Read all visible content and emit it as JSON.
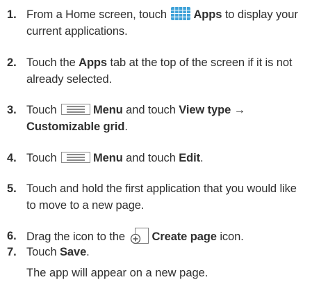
{
  "steps": [
    {
      "num": "1.",
      "line1_a": "From a Home screen, touch ",
      "apps_label": "Apps",
      "line1_b": " to display your",
      "line2": "current applications."
    },
    {
      "num": "2.",
      "line1_a": "Touch the ",
      "apps_tab": "Apps",
      "line1_b": " tab at the top of the screen if it is not",
      "line2": "already selected."
    },
    {
      "num": "3.",
      "line1_a": "Touch ",
      "menu_label": "Menu",
      "line1_b": " and touch ",
      "view_type": "View type",
      "arrow": "→",
      "line2": "Customizable grid",
      "line2_end": "."
    },
    {
      "num": "4.",
      "line1_a": "Touch ",
      "menu_label": "Menu",
      "line1_b": " and touch ",
      "edit_label": "Edit",
      "line1_end": "."
    },
    {
      "num": "5.",
      "line1": "Touch and hold the first application that you would like",
      "line2": "to move to a new page."
    },
    {
      "num": "6.",
      "line1_a": "Drag the icon to the ",
      "create_page_label": "Create page",
      "line1_b": " icon."
    },
    {
      "num": "7.",
      "line1_a": "Touch ",
      "save_label": "Save",
      "line1_end": ".",
      "result": "The app will appear on a new page."
    }
  ],
  "colors": {
    "text": "#2f2f2f",
    "apps_icon": "#3fa2d8",
    "menu_icon": "#8a8a8a"
  }
}
